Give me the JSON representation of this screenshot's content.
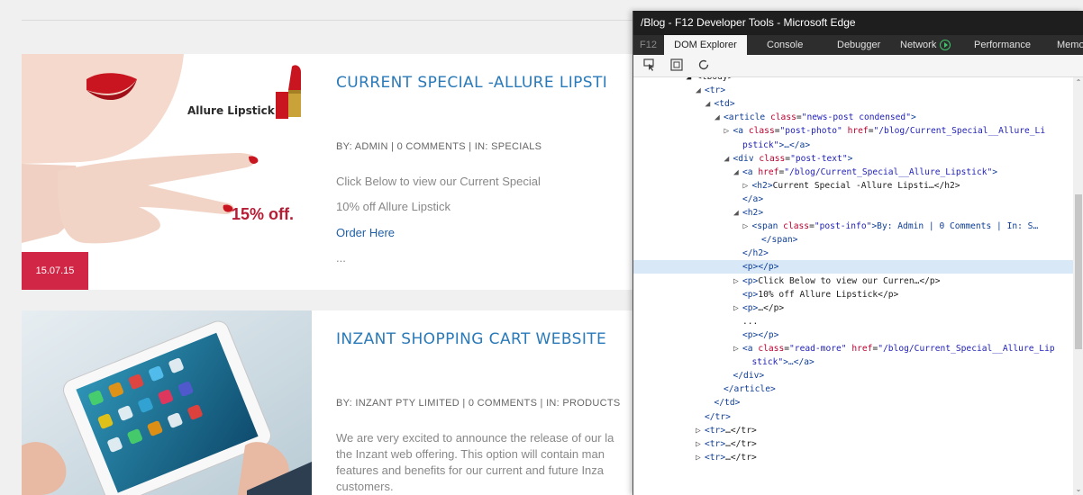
{
  "blog": {
    "posts": [
      {
        "image_label": "Allure Lipstick",
        "image_discount": "15% off.",
        "date": "15.07.15",
        "title": "CURRENT SPECIAL -ALLURE LIPSTI",
        "info": "BY: ADMIN | 0 COMMENTS | IN: SPECIALS",
        "lines": [
          "Click Below to view our Current Special",
          "10% off Allure Lipstick"
        ],
        "link": "Order Here",
        "ellipsis": "..."
      },
      {
        "title": "INZANT SHOPPING CART WEBSITE",
        "info": "BY: INZANT PTY LIMITED | 0 COMMENTS | IN: PRODUCTS",
        "lines": [
          "We are very excited to announce the release of our la",
          "the Inzant web offering. This option will contain man",
          "features and benefits for our current and future Inza",
          "customers."
        ]
      }
    ]
  },
  "devtools": {
    "title": "/Blog - F12 Developer Tools - Microsoft Edge",
    "tabs": {
      "f12": "F12",
      "dom": "DOM Explorer",
      "console": "Console",
      "debugger": "Debugger",
      "network": "Network",
      "performance": "Performance",
      "memory": "Memo"
    },
    "tree": [
      {
        "indent": 5,
        "text": "◢ <tbody>"
      },
      {
        "indent": 6,
        "tri": "◢",
        "tag": "<tr>"
      },
      {
        "indent": 7,
        "tri": "◢",
        "tag": "<td>"
      },
      {
        "indent": 8,
        "tri": "◢",
        "tag": "<article",
        "attr": "class",
        "val": "\"news-post condensed\"",
        "end": ">"
      },
      {
        "indent": 9,
        "tri": "▷",
        "tag": "<a",
        "attr": "class",
        "val": "\"post-photo\"",
        "attr2": "href",
        "val2": "\"/blog/Current_Special__Allure_Li",
        "end": ""
      },
      {
        "indent": 10,
        "tri": "",
        "val": "pstick\"",
        "end": ">…</a>"
      },
      {
        "indent": 9,
        "tri": "◢",
        "tag": "<div",
        "attr": "class",
        "val": "\"post-text\"",
        "end": ">"
      },
      {
        "indent": 10,
        "tri": "◢",
        "tag": "<a",
        "attr": "href",
        "val": "\"/blog/Current_Special__Allure_Lipstick\"",
        "end": ">"
      },
      {
        "indent": 11,
        "tri": "▷",
        "tag": "<h2>",
        "text": "Current Special -Allure Lipsti…</h2>"
      },
      {
        "indent": 10,
        "tri": "",
        "tag": "</a>"
      },
      {
        "indent": 10,
        "tri": "◢",
        "tag": "<h2>"
      },
      {
        "indent": 11,
        "tri": "▷",
        "tag": "<span",
        "attr": "class",
        "val": "\"post-info\"",
        "end": ">By: Admin | 0 Comments | In: S…"
      },
      {
        "indent": 12,
        "tri": "",
        "tag": "</span>"
      },
      {
        "indent": 10,
        "tri": "",
        "tag": "</h2>"
      },
      {
        "indent": 10,
        "tri": "",
        "tag": "<p></p>",
        "selected": true
      },
      {
        "indent": 10,
        "tri": "▷",
        "tag": "<p>",
        "text": "Click Below to view our Curren…</p>"
      },
      {
        "indent": 10,
        "tri": "",
        "tag": "<p>",
        "text": "10% off Allure Lipstick</p>"
      },
      {
        "indent": 10,
        "tri": "▷",
        "tag": "<p>",
        "text": "…</p>"
      },
      {
        "indent": 10,
        "tri": "",
        "text": "..."
      },
      {
        "indent": 10,
        "tri": "",
        "tag": "<p></p>"
      },
      {
        "indent": 10,
        "tri": "▷",
        "tag": "<a",
        "attr": "class",
        "val": "\"read-more\"",
        "attr2": "href",
        "val2": "\"/blog/Current_Special__Allure_Lip",
        "end": ""
      },
      {
        "indent": 11,
        "tri": "",
        "val": "stick\"",
        "end": ">…</a>"
      },
      {
        "indent": 9,
        "tri": "",
        "tag": "</div>"
      },
      {
        "indent": 8,
        "tri": "",
        "tag": "</article>"
      },
      {
        "indent": 7,
        "tri": "",
        "tag": "</td>"
      },
      {
        "indent": 6,
        "tri": "",
        "tag": "</tr>"
      },
      {
        "indent": 6,
        "tri": "▷",
        "tag": "<tr>",
        "text": "…</tr>"
      },
      {
        "indent": 6,
        "tri": "▷",
        "tag": "<tr>",
        "text": "…</tr>"
      },
      {
        "indent": 6,
        "tri": "▷",
        "tag": "<tr>",
        "text": "…</tr>"
      }
    ]
  },
  "colors": {
    "title_blue": "#2a7ab9",
    "date_badge": "#d12645",
    "devtools_titlebar": "#1e1e1e",
    "selected_row": "#d8e8f6"
  }
}
